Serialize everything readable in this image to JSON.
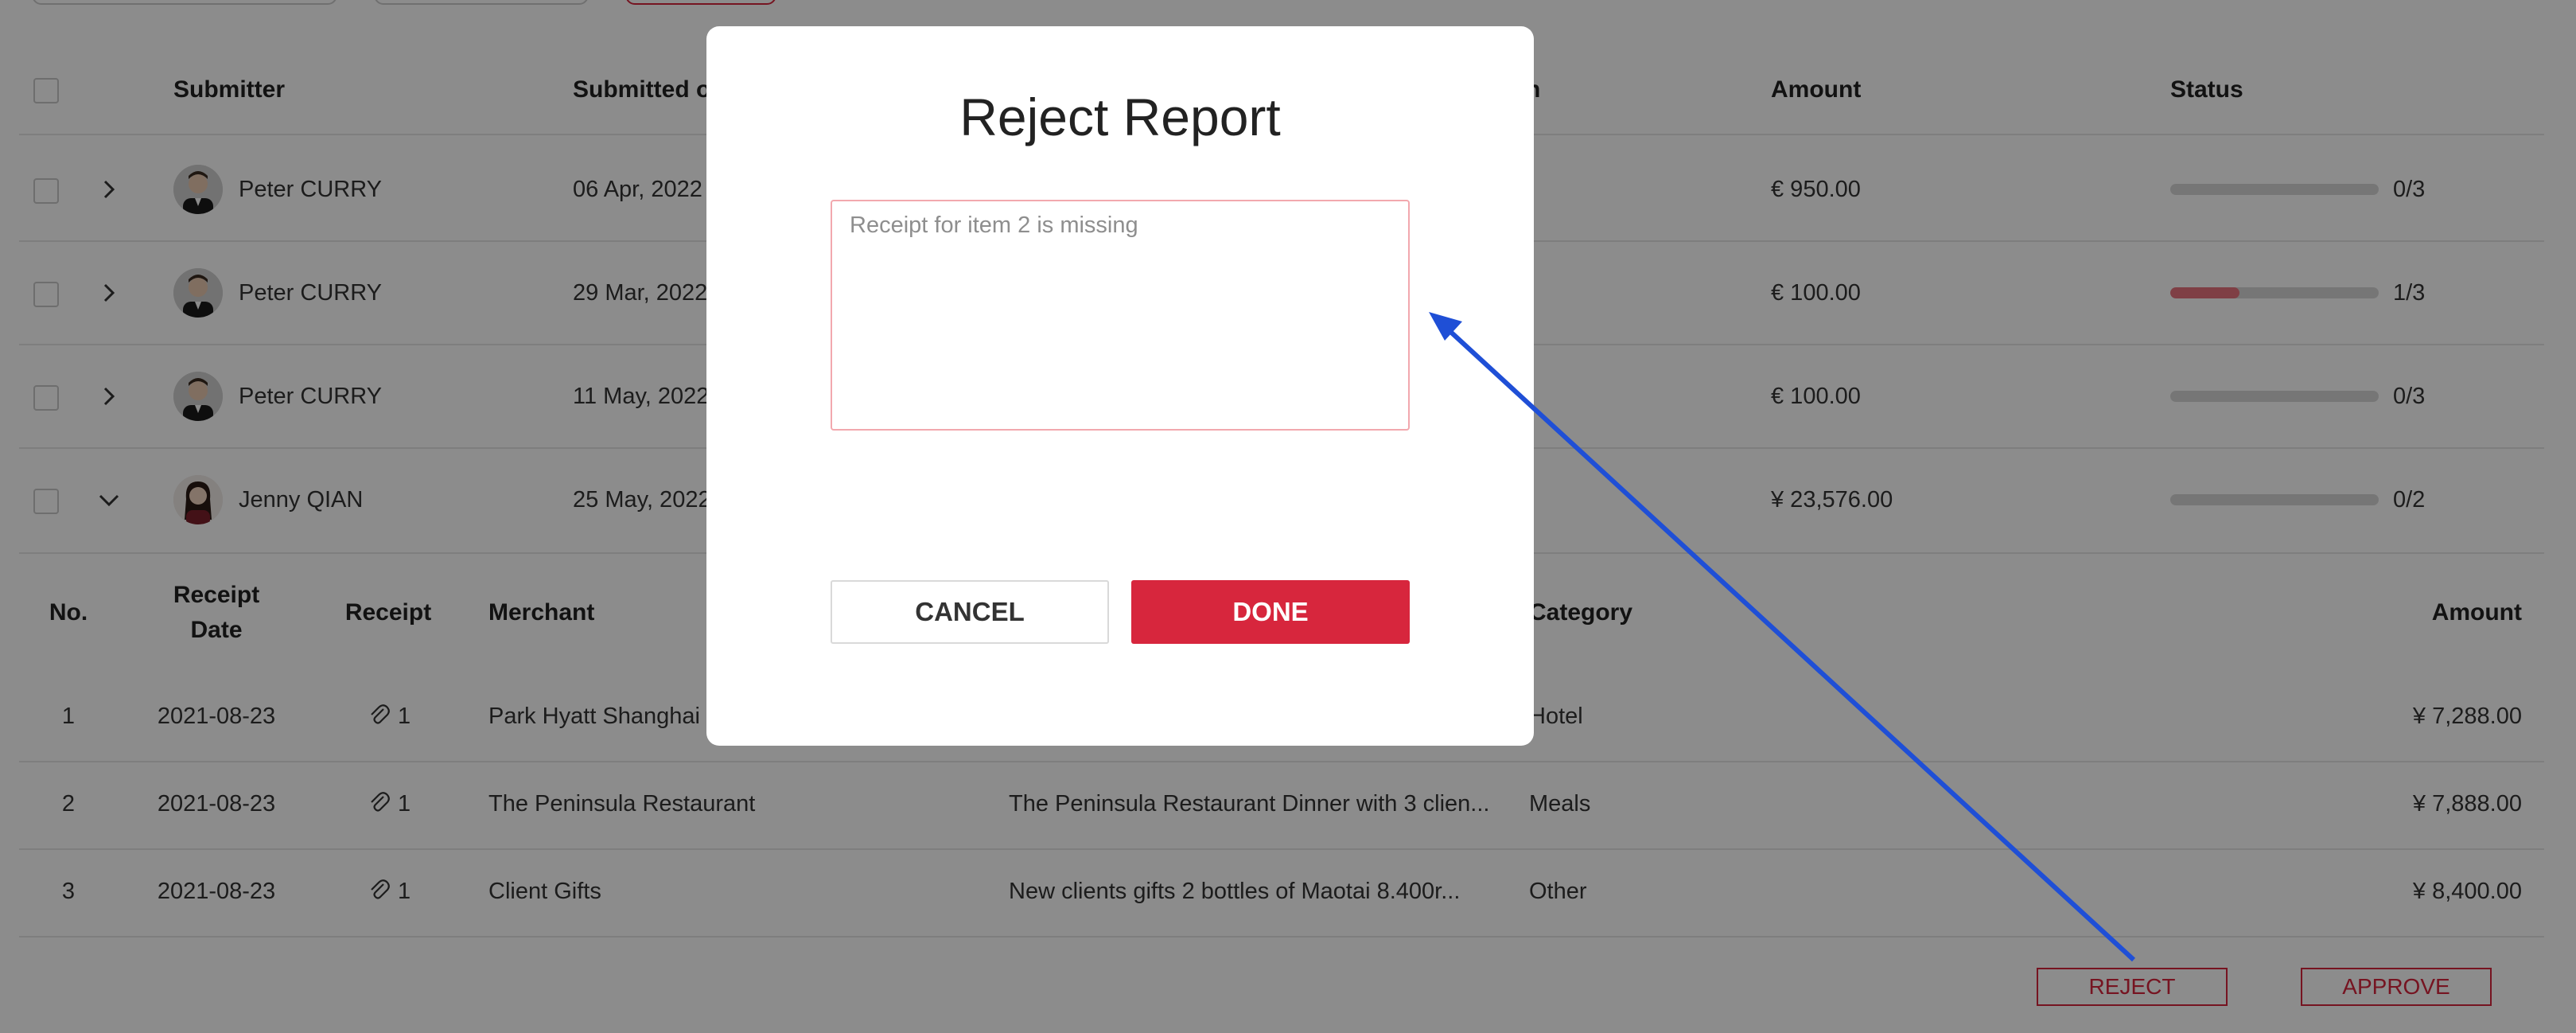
{
  "table": {
    "headers": {
      "submitter": "Submitter",
      "submitted_on": "Submitted o",
      "hidden_col_tail": "n",
      "amount": "Amount",
      "status": "Status"
    },
    "rows": [
      {
        "name": "Peter CURRY",
        "date": "06 Apr, 2022",
        "amount": "€ 950.00",
        "progress": 0,
        "progress_text": "0/3",
        "expanded": false
      },
      {
        "name": "Peter CURRY",
        "date": "29 Mar, 2022",
        "amount": "€ 100.00",
        "progress": 0.333,
        "progress_text": "1/3",
        "expanded": false
      },
      {
        "name": "Peter CURRY",
        "date": "11 May, 2022",
        "amount": "€ 100.00",
        "progress": 0,
        "progress_text": "0/3",
        "expanded": false
      },
      {
        "name": "Jenny QIAN",
        "date": "25 May, 2022",
        "amount": "¥ 23,576.00",
        "progress": 0,
        "progress_text": "0/2",
        "expanded": true
      }
    ]
  },
  "receipts": {
    "headers": {
      "no": "No.",
      "receipt_date": "Receipt Date",
      "receipt": "Receipt",
      "merchant": "Merchant",
      "category": "Category",
      "amount": "Amount"
    },
    "rows": [
      {
        "no": "1",
        "date": "2021-08-23",
        "attachments": "1",
        "merchant": "Park Hyatt Shanghai",
        "description": "",
        "category": "Hotel",
        "amount": "¥ 7,288.00"
      },
      {
        "no": "2",
        "date": "2021-08-23",
        "attachments": "1",
        "merchant": "The Peninsula Restaurant",
        "description": "The Peninsula Restaurant Dinner with 3 clien...",
        "category": "Meals",
        "amount": "¥ 7,888.00"
      },
      {
        "no": "3",
        "date": "2021-08-23",
        "attachments": "1",
        "merchant": "Client Gifts",
        "description": "New clients gifts 2 bottles of Maotai 8.400r...",
        "category": "Other",
        "amount": "¥ 8,400.00"
      }
    ]
  },
  "actions": {
    "reject": "REJECT",
    "approve": "APPROVE"
  },
  "modal": {
    "title": "Reject Report",
    "reason_placeholder": "Receipt for item 2 is missing",
    "cancel": "CANCEL",
    "done": "DONE"
  },
  "colors": {
    "accent": "#d7263d",
    "progress_fill": "#e8747f",
    "annotation_arrow": "#1f4fd6"
  }
}
